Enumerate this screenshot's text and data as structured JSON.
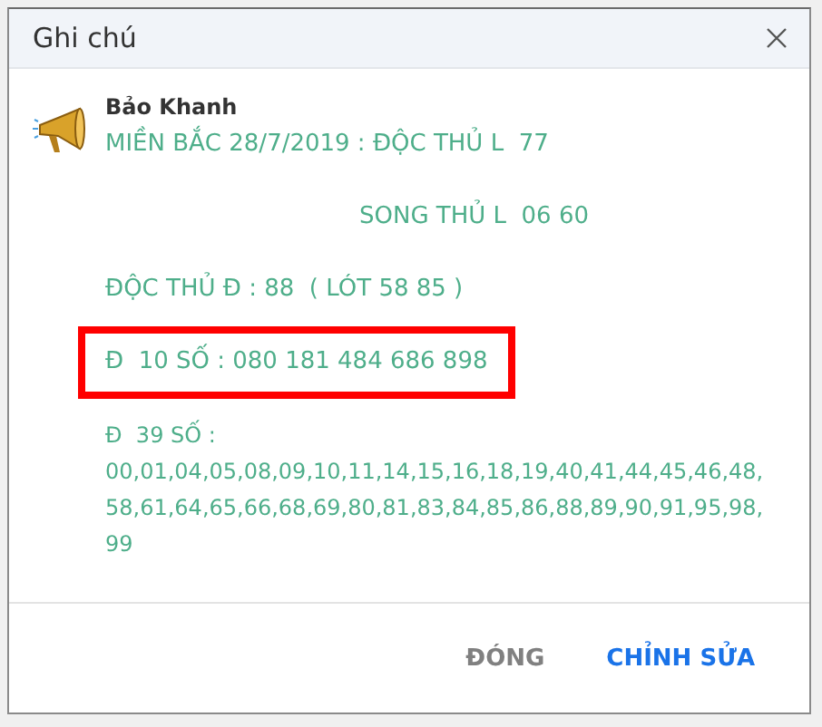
{
  "window": {
    "title": "Ghi chú"
  },
  "note": {
    "author": "Bảo Khanh",
    "lines": [
      {
        "text": "MIỀN BẮC 28/7/2019 : ĐỘC THỦ L  77",
        "kind": "plain",
        "highlighted": false
      },
      {
        "text": "SONG THỦ L  06 60",
        "kind": "indented",
        "highlighted": false
      },
      {
        "text": "ĐỘC THỦ Đ : 88  ( LÓT 58 85 )",
        "kind": "plain",
        "highlighted": false
      },
      {
        "text": "Đ  10 SỐ : 080 181 484 686 898",
        "kind": "plain",
        "highlighted": true
      },
      {
        "text": "Đ  39 SỐ :",
        "kind": "tight",
        "highlighted": false
      },
      {
        "text": "00,01,04,05,08,09,10,11,14,15,16,18,19,40,41,44,45,46,48,",
        "kind": "tight",
        "highlighted": false
      },
      {
        "text": "58,61,64,65,66,68,69,80,81,83,84,85,86,88,89,90,91,95,98,",
        "kind": "tight",
        "highlighted": false
      },
      {
        "text": "99",
        "kind": "tight",
        "highlighted": false
      }
    ]
  },
  "buttons": [
    {
      "label": "ĐÓNG",
      "kind": "secondary"
    },
    {
      "label": "CHỈNH SỬA",
      "kind": "primary"
    }
  ]
}
